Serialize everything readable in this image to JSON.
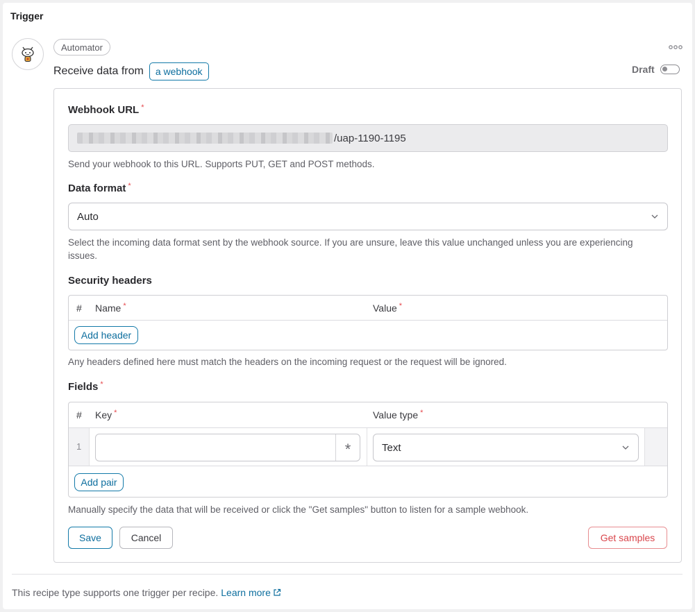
{
  "section": {
    "title": "Trigger"
  },
  "app": {
    "name": "Automator"
  },
  "receive": {
    "prefix": "Receive data from",
    "source": "a webhook"
  },
  "status": {
    "label": "Draft"
  },
  "webhook_url": {
    "label": "Webhook URL",
    "required_mark": "*",
    "value_suffix": "/uap-1190-1195",
    "help": "Send your webhook to this URL. Supports PUT, GET and POST methods."
  },
  "data_format": {
    "label": "Data format",
    "required_mark": "*",
    "selected": "Auto",
    "help": "Select the incoming data format sent by the webhook source. If you are unsure, leave this value unchanged unless you are experiencing issues."
  },
  "security_headers": {
    "label": "Security headers",
    "columns": {
      "index": "#",
      "name": "Name",
      "value": "Value"
    },
    "required_mark": "*",
    "add_label": "Add header",
    "help": "Any headers defined here must match the headers on the incoming request or the request will be ignored."
  },
  "fields": {
    "label": "Fields",
    "required_mark": "*",
    "columns": {
      "index": "#",
      "key": "Key",
      "value_type": "Value type"
    },
    "rows": [
      {
        "index": "1",
        "key_value": "",
        "formula_symbol": "*",
        "value_type": "Text"
      }
    ],
    "add_label": "Add pair",
    "help": "Manually specify the data that will be received or click the \"Get samples\" button to listen for a sample webhook."
  },
  "actions": {
    "save": "Save",
    "cancel": "Cancel",
    "samples": "Get samples"
  },
  "footer": {
    "text": "This recipe type supports one trigger per recipe.",
    "link": "Learn more"
  },
  "colors": {
    "accent": "#0d6e9e",
    "required": "#e5484d",
    "danger": "#d9464c"
  }
}
